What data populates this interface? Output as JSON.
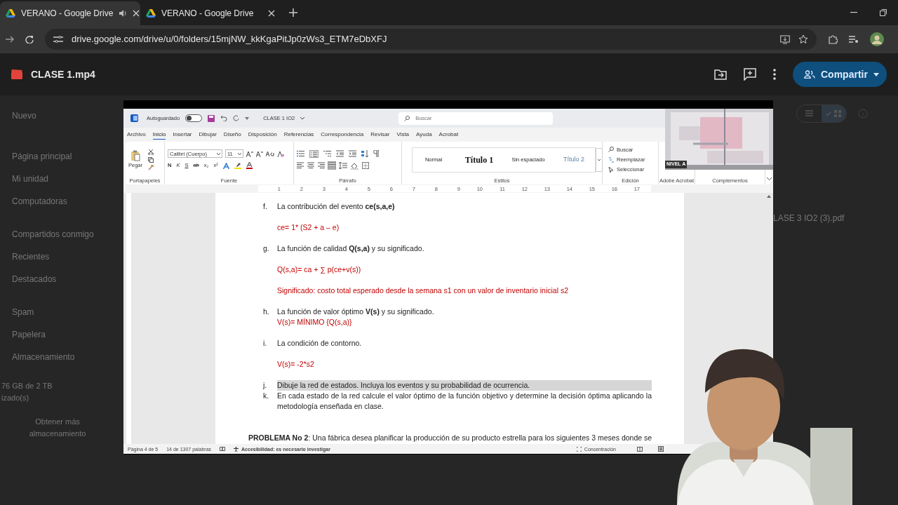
{
  "browser": {
    "tabs": [
      {
        "title": "VERANO - Google Drive",
        "selected": true,
        "audio": true
      },
      {
        "title": "VERANO - Google Drive",
        "selected": false,
        "audio": false
      }
    ],
    "url": "drive.google.com/drive/u/0/folders/15mjNW_kkKgaPitJp0zWs3_ETM7eDbXFJ"
  },
  "viewer": {
    "file_name": "CLASE 1.mp4",
    "share_button": "Compartir"
  },
  "drive_sidebar": {
    "new_button": "Nuevo",
    "items": [
      "Página principal",
      "Mi unidad",
      "Computadoras",
      "Compartidos conmigo",
      "Recientes",
      "Destacados",
      "Spam",
      "Papelera",
      "Almacenamiento"
    ],
    "storage": [
      "76 GB de 2 TB",
      "izado(s)"
    ],
    "more_storage": "Obtener más almacenamiento"
  },
  "drive_right": {
    "file": "LASE 3 IO2 (3).pdf",
    "views": [
      {
        "kind": "list",
        "selected": false
      },
      {
        "kind": "grid",
        "selected": true
      }
    ]
  },
  "word": {
    "autosave_label": "Autoguardado",
    "autosave_on": false,
    "doc_title": "CLASE 1 IO2",
    "search_placeholder": "Buscar",
    "tabs": [
      {
        "label": "Archivo",
        "selected": false
      },
      {
        "label": "Inicio",
        "selected": true
      },
      {
        "label": "Insertar",
        "selected": false
      },
      {
        "label": "Dibujar",
        "selected": false
      },
      {
        "label": "Diseño",
        "selected": false
      },
      {
        "label": "Disposición",
        "selected": false
      },
      {
        "label": "Referencias",
        "selected": false
      },
      {
        "label": "Correspondencia",
        "selected": false
      },
      {
        "label": "Revisar",
        "selected": false
      },
      {
        "label": "Vista",
        "selected": false
      },
      {
        "label": "Ayuda",
        "selected": false
      },
      {
        "label": "Acrobat",
        "selected": false
      }
    ],
    "paste_label": "Pegar",
    "font_name": "Calibri (Cuerpo)",
    "font_size": "11",
    "font_buttons": [
      "N",
      "K",
      "S",
      "ab",
      "x₂",
      "x²"
    ],
    "styles": [
      {
        "kind": "normal",
        "label": "Normal"
      },
      {
        "kind": "title1",
        "label": "Título 1"
      },
      {
        "kind": "nospacing",
        "label": "Sin espaciado"
      },
      {
        "kind": "title2",
        "label": "Título 2"
      }
    ],
    "editing": [
      "Buscar",
      "Reemplazar",
      "Seleccionar"
    ],
    "groups": [
      "Portapapeles",
      "Fuente",
      "Párrafo",
      "Estilos",
      "Edición",
      "Adobe Acrobat",
      "Complementos"
    ],
    "ruler": [
      "1",
      "2",
      "3",
      "4",
      "5",
      "6",
      "7",
      "8",
      "9",
      "10",
      "11",
      "12",
      "13",
      "14",
      "15",
      "16",
      "17"
    ],
    "document": [
      {
        "kind": "item",
        "marker": "f.",
        "text": "La contribución del evento **ce(s,a,e)**",
        "highlight": false
      },
      {
        "kind": "blank"
      },
      {
        "kind": "answer",
        "text": "ce= 1* (S2 + a – e)"
      },
      {
        "kind": "blank"
      },
      {
        "kind": "item",
        "marker": "g.",
        "text": "La función de calidad **Q(s,a)** y su significado.",
        "highlight": false
      },
      {
        "kind": "blank"
      },
      {
        "kind": "answer",
        "text": "Q(s,a)= ca + ∑ p(ce+v(s))"
      },
      {
        "kind": "blank"
      },
      {
        "kind": "answer",
        "text": "Significado: costo total esperado desde la semana s1 con un valor de inventario inicial s2"
      },
      {
        "kind": "blank"
      },
      {
        "kind": "item",
        "marker": "h.",
        "text": "La función de valor óptimo **V(s)** y su significado.",
        "highlight": false
      },
      {
        "kind": "answer",
        "text": "V(s)= MÍNIMO {Q(s,a)}"
      },
      {
        "kind": "blank"
      },
      {
        "kind": "item",
        "marker": "i.",
        "text": "La condición de contorno.",
        "highlight": false
      },
      {
        "kind": "blank"
      },
      {
        "kind": "answer",
        "text": "V(s)= -2*s2"
      },
      {
        "kind": "blank"
      },
      {
        "kind": "item",
        "marker": "j.",
        "text": "Dibuje la red de estados. Incluya los eventos y su probabilidad de ocurrencia.",
        "highlight": true
      },
      {
        "kind": "item",
        "marker": "k.",
        "text": "En cada estado de la red calcule el valor óptimo de la función objetivo y determine la decisión óptima aplicando la metodología enseñada en clase.",
        "highlight": false
      },
      {
        "kind": "blank"
      },
      {
        "kind": "blank"
      },
      {
        "kind": "paragraph",
        "text": "**PROBLEMA No 2**: Una fábrica desea planificar la producción de su producto estrella para los siguientes 3 meses donde se"
      }
    ],
    "status": {
      "page": "Página 4 de 5",
      "words": "14 de 1307 palabras",
      "accessibility": "Accesibilidad: es necesario investigar",
      "focus": "Concentración"
    },
    "webcam_label": "NIVEL A"
  }
}
